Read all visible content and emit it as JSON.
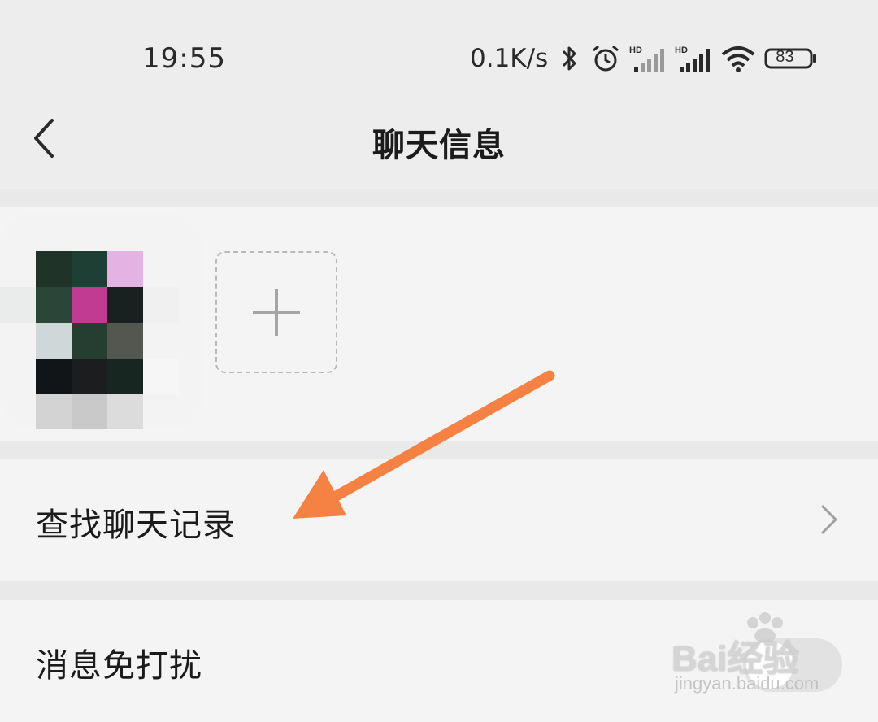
{
  "status_bar": {
    "time": "19:55",
    "network_speed": "0.1K/s",
    "battery_level": "83",
    "icons": [
      "bluetooth-icon",
      "alarm-icon",
      "signal-hd-1-icon",
      "signal-hd-2-icon",
      "wifi-icon",
      "battery-icon"
    ],
    "signal_label": "HD"
  },
  "nav_bar": {
    "back_icon": "chevron-left-icon",
    "title": "聊天信息"
  },
  "members": {
    "avatar_icon": "pixelated-avatar",
    "add_icon": "plus-icon"
  },
  "settings": {
    "search_history_label": "查找聊天记录",
    "mute_label": "消息免打扰",
    "mute_enabled": false
  },
  "annotation": {
    "arrow_color": "#f58242"
  },
  "watermark": {
    "logo": "Bai经验",
    "url": "jingyan.baidu.com"
  },
  "colors": {
    "background": "#e9e9e9",
    "section": "#f4f4f4"
  }
}
